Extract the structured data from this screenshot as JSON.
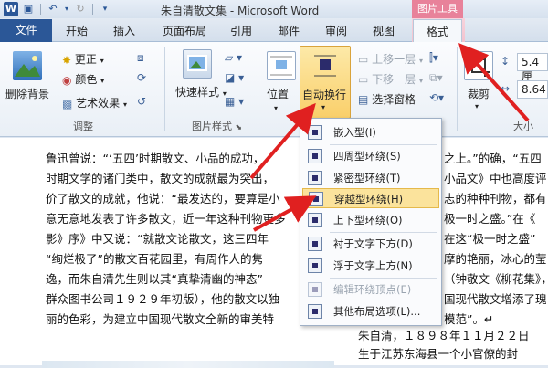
{
  "window": {
    "title": "朱自清散文集 - Microsoft Word",
    "context_tool_title": "图片工具"
  },
  "quick_access": [
    "save-icon",
    "undo-icon",
    "redo-icon",
    "customize-icon"
  ],
  "tabs": {
    "file": "文件",
    "items": [
      "开始",
      "插入",
      "页面布局",
      "引用",
      "邮件",
      "审阅",
      "视图"
    ],
    "format": "格式"
  },
  "ribbon": {
    "adjust": {
      "remove_bg": "删除背景",
      "corrections": "更正",
      "color": "颜色",
      "artistic": "艺术效果",
      "label": "调整"
    },
    "picture_styles": {
      "quick_styles": "快速样式",
      "label": "图片样式"
    },
    "arrange": {
      "position": "位置",
      "wrap_text": "自动换行",
      "bring_forward": "上移一层",
      "send_backward": "下移一层",
      "selection_pane": "选择窗格"
    },
    "size": {
      "crop": "裁剪",
      "height": "5.4 厘",
      "width": "8.64",
      "label": "大小"
    }
  },
  "wrap_menu": {
    "items": [
      {
        "label": "嵌入型(I)",
        "enabled": true
      },
      {
        "label": "四周型环绕(S)",
        "enabled": true
      },
      {
        "label": "紧密型环绕(T)",
        "enabled": true
      },
      {
        "label": "穿越型环绕(H)",
        "enabled": true,
        "highlighted": true
      },
      {
        "label": "上下型环绕(O)",
        "enabled": true
      },
      {
        "label": "衬于文字下方(D)",
        "enabled": true
      },
      {
        "label": "浮于文字上方(N)",
        "enabled": true
      },
      {
        "label": "编辑环绕顶点(E)",
        "enabled": false
      },
      {
        "label": "其他布局选项(L)...",
        "enabled": true
      }
    ]
  },
  "document": {
    "lines": [
      "鲁迅曾说：“‘五四’时期散文、小品的成功，",
      "时期文学的诸门类中，散文的成就最为突出，",
      "价了散文的成就，他说：“最发达的，要算是小",
      "意无意地发表了许多散文，近一年这种刊物更多",
      "影》序》中又说：“就散文论散文，这三四年",
      "“绚烂极了”的散文百花园里，有周作人的隽",
      "逸，而朱自清先生则以其“真挚清幽的神态”",
      "群众图书公司１９２９年初版），他的散文以独",
      "丽的色彩，为建立中国现代散文全新的审美特"
    ],
    "right_lines": [
      "之上。”的确，“五四",
      "小品文》中也高度评",
      "志的种种刊物，都有",
      "极一时之盛。”在《",
      "在这“极一时之盛”",
      "摩的艳丽，冰心的莹",
      "（钟敬文《柳花集》，",
      "国现代散文增添了瑰",
      "模范”。↵",
      "朱自清，１８９８年１１月２２日",
      "生于江苏东海县一个小官僚的封"
    ]
  }
}
